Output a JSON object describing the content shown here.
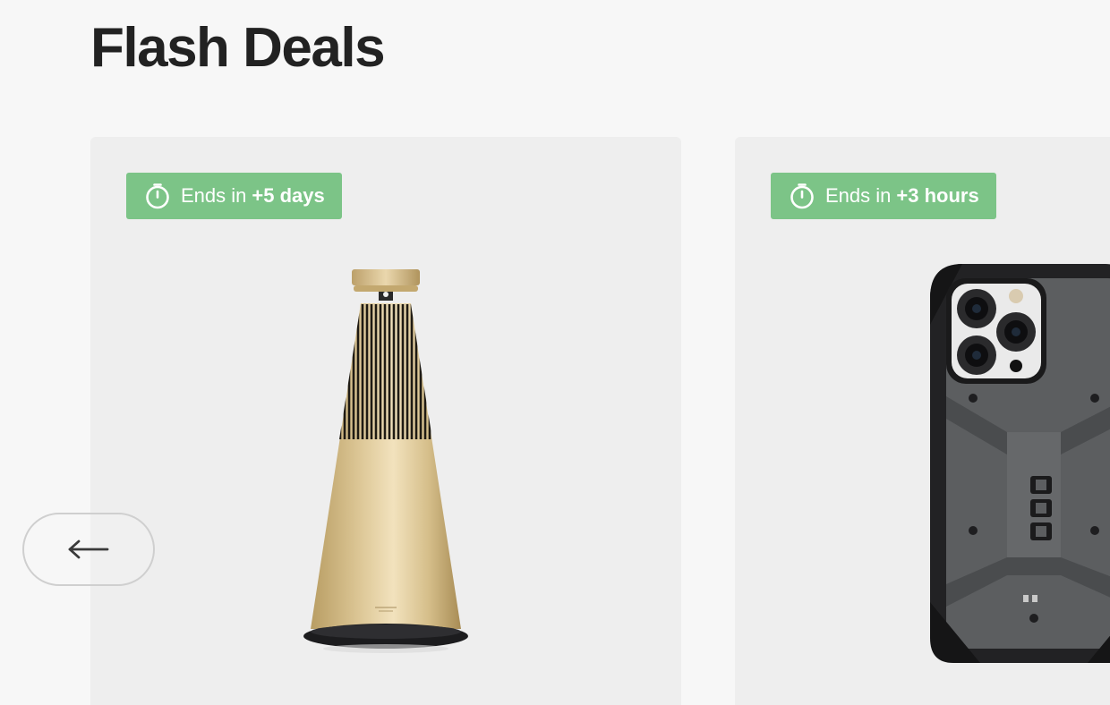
{
  "section": {
    "title": "Flash Deals"
  },
  "carousel": {
    "prev_icon": "arrow-left-icon",
    "cards": [
      {
        "badge": {
          "prefix": "Ends in",
          "amount": "+5 days",
          "icon": "timer-icon"
        },
        "product": "speaker"
      },
      {
        "badge": {
          "prefix": "Ends in",
          "amount": "+3 hours",
          "icon": "timer-icon"
        },
        "product": "phone-case"
      }
    ]
  },
  "colors": {
    "page_background": "#f7f7f7",
    "card_background": "#eeeeee",
    "badge_green": "#7cc487",
    "title_text": "#222222",
    "speaker_gold": "#d9c28f",
    "case_gray": "#5a5c5e"
  }
}
